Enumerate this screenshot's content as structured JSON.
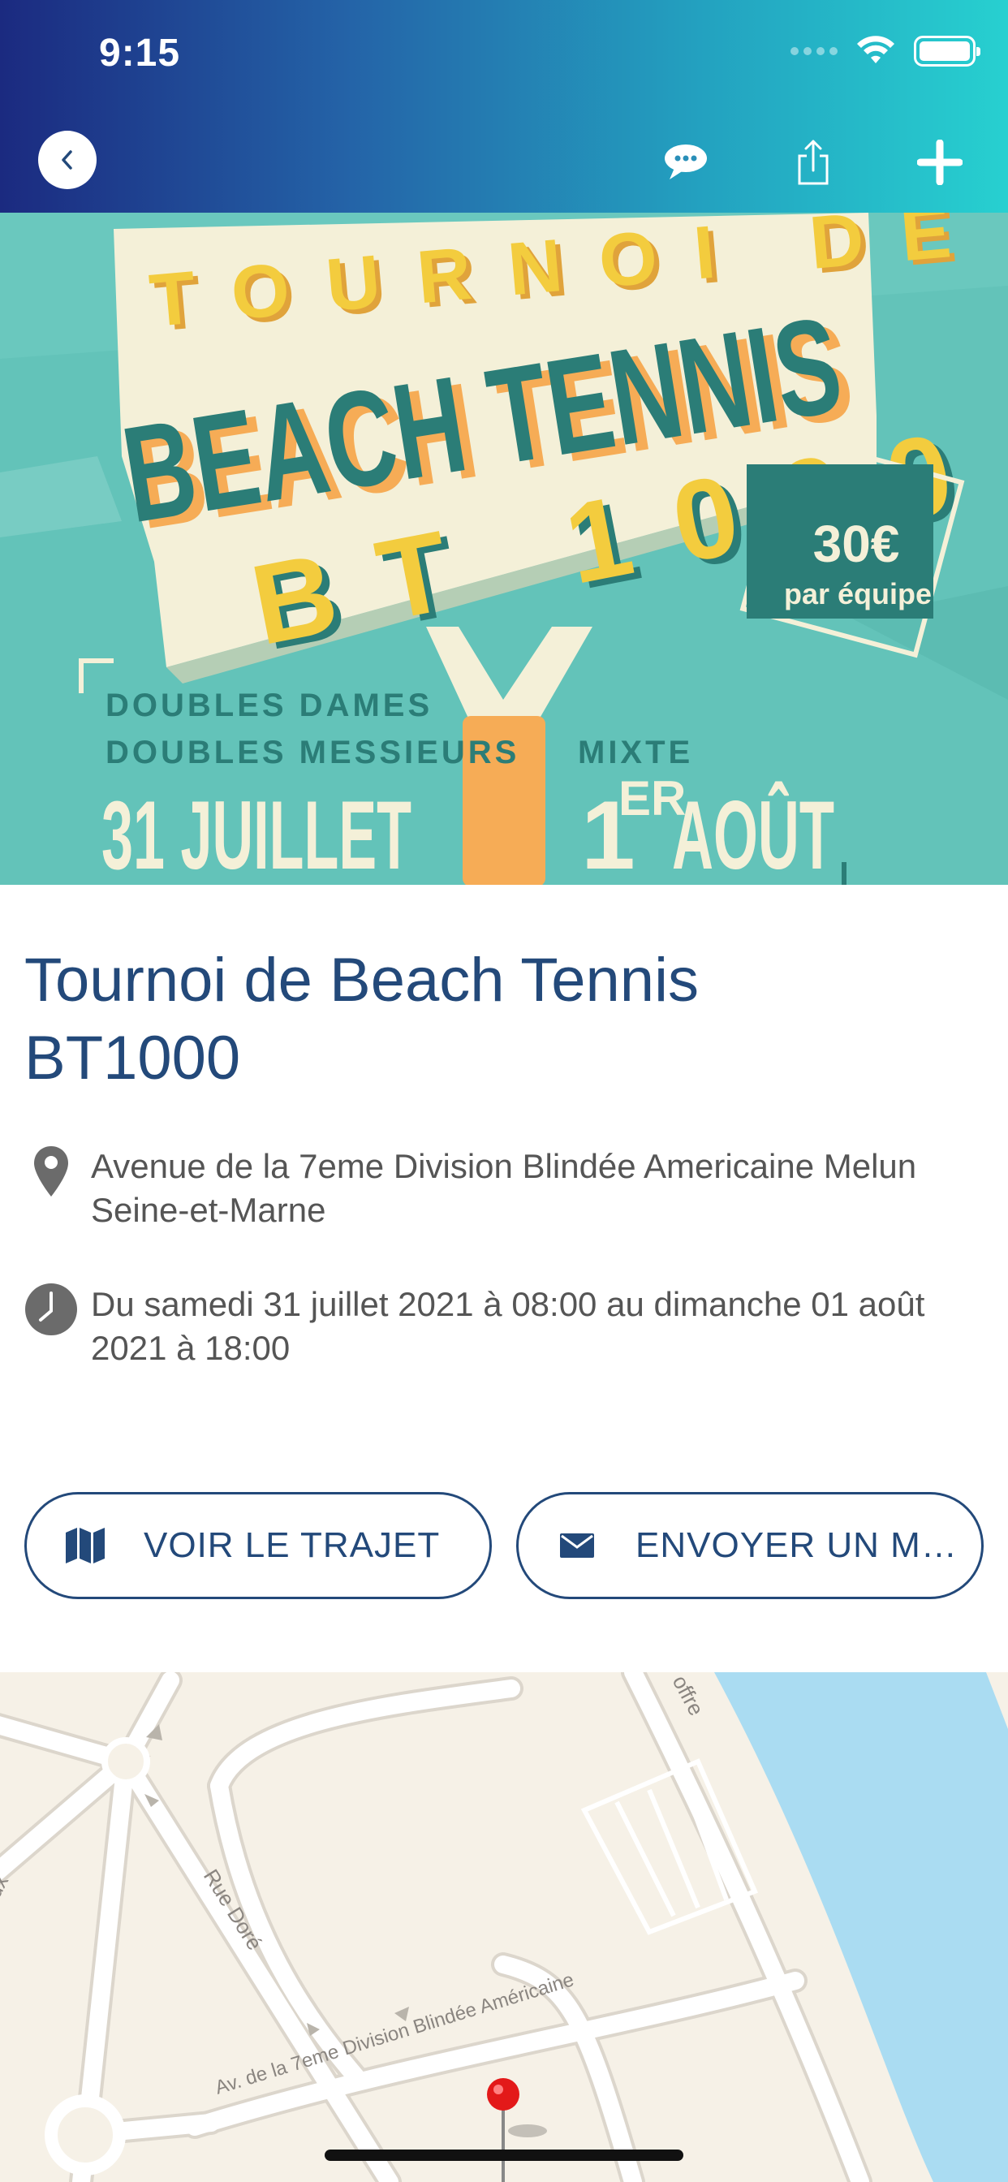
{
  "status_bar": {
    "time": "9:15"
  },
  "header": {
    "back_icon": "chevron-left-icon",
    "chat_icon": "chat-bubble-icon",
    "share_icon": "share-icon",
    "add_icon": "plus-icon"
  },
  "poster": {
    "line1": "TOURNOI DE",
    "line2": "BEACH TENNIS",
    "line3": "BT 1000",
    "price": "30€",
    "price_sub": "par équipe",
    "category1": "DOUBLES DAMES",
    "category2": "DOUBLES MESSIEURS",
    "date1": "31 JUILLET",
    "category3": "MIXTE",
    "date2_num": "1",
    "date2_sup": "ER",
    "date2_month": "AOÛT"
  },
  "event": {
    "title": "Tournoi de Beach Tennis BT1000",
    "address": "Avenue de la 7eme Division Blindée Americaine Melun Seine-et-Marne",
    "datetime": "Du samedi 31 juillet 2021 à 08:00 au dimanche 01 août 2021 à 18:00"
  },
  "actions": {
    "route_label": "VOIR LE TRAJET",
    "message_label": "ENVOYER UN M…"
  },
  "map": {
    "street1": "Rue Doré",
    "street2": "Av. de la 7eme Division Blindée Américaine",
    "street3": "offre",
    "street4": "ux"
  },
  "colors": {
    "primary": "#23497a",
    "header_start": "#1b2a80",
    "header_end": "#27d0d0",
    "poster_bg": "#63c3b9",
    "poster_dark": "#2b7d77",
    "poster_yellow": "#f3cc3e",
    "poster_cream": "#f4f0d8",
    "poster_orange": "#f6ac56",
    "water": "#aadcf2",
    "pin": "#e31919"
  }
}
